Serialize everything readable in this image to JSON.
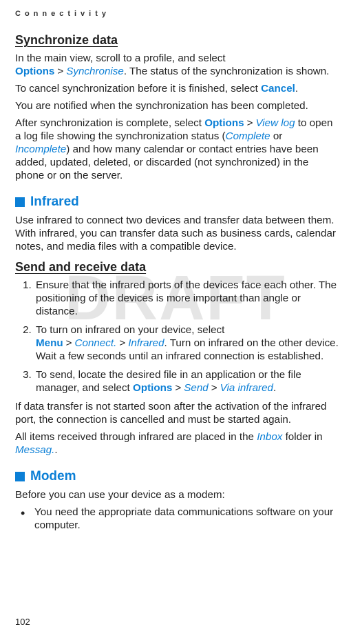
{
  "header": {
    "running": "Connectivity"
  },
  "watermark": "DRAFT",
  "sync": {
    "title": "Synchronize data",
    "p1_a": "In the main view, scroll to a profile, and select ",
    "options": "Options",
    "gt": ">",
    "synchronise": "Synchronise",
    "p1_b": ". The status of the synchronization is shown.",
    "p2_a": "To cancel synchronization before it is finished, select ",
    "cancel": "Cancel",
    "p2_b": ".",
    "p3": "You are notified when the synchronization has been completed.",
    "p4_a": "After synchronization is complete, select ",
    "viewlog": "View log",
    "p4_b": " to open a log file showing the synchronization status (",
    "complete": "Complete",
    "or": " or ",
    "incomplete": "Incomplete",
    "p4_c": ") and how many calendar or contact entries have been added, updated, deleted, or discarded (not synchronized) in the phone or on the server."
  },
  "infrared": {
    "title": "Infrared",
    "intro": "Use infrared to connect two devices and transfer data between them. With infrared, you can transfer data such as business cards, calendar notes, and media files with a compatible device.",
    "send_title": "Send and receive data",
    "li1": "Ensure that the infrared ports of the devices face each other. The positioning of the devices is more important than angle or distance.",
    "li2_a": "To turn on infrared on your device, select ",
    "menu": "Menu",
    "connect": "Connect.",
    "infrared_item": "Infrared",
    "li2_b": ". Turn on infrared on the other device. Wait a few seconds until an infrared connection is established.",
    "li3_a": "To send, locate the desired file in an application or the file manager, and select ",
    "send": "Send",
    "via_infrared": "Via infrared",
    "li3_b": ".",
    "after1": "If data transfer is not started soon after the activation of the infrared port, the connection is cancelled and must be started again.",
    "after2_a": "All items received through infrared are placed in the ",
    "inbox": "Inbox",
    "after2_b": " folder in ",
    "messag": "Messag.",
    "after2_c": "."
  },
  "modem": {
    "title": "Modem",
    "intro": "Before you can use your device as a modem:",
    "li1": "You need the appropriate data communications software on your computer."
  },
  "page_number": "102"
}
